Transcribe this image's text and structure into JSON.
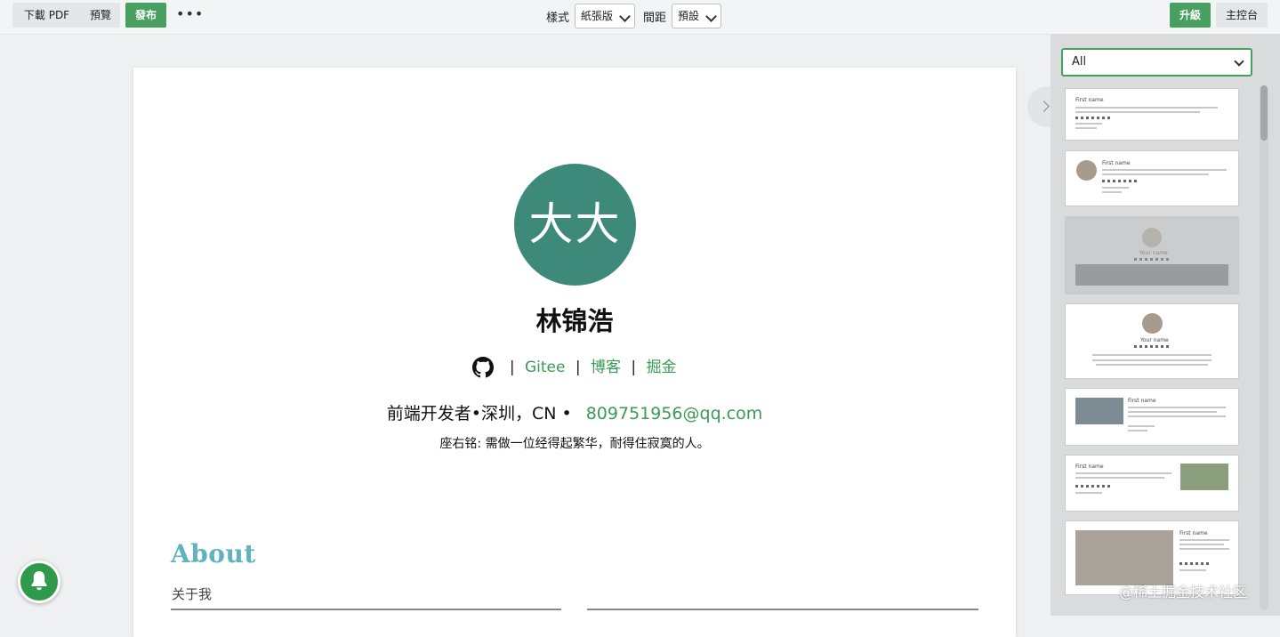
{
  "toolbar": {
    "download_pdf": "下載 PDF",
    "preview": "預覽",
    "publish": "發布",
    "more": "•••",
    "style_label": "樣式",
    "style_value": "紙張版",
    "spacing_label": "間距",
    "spacing_value": "預設",
    "upgrade": "升級",
    "dashboard": "主控台"
  },
  "resume": {
    "avatar_text": "大大",
    "name": "林锦浩",
    "links": [
      "Gitee",
      "博客",
      "掘金"
    ],
    "link_sep": "|",
    "info": "前端开发者•深圳，CN •",
    "email": "809751956@qq.com",
    "motto": "座右铭: 需做一位经得起繁华，耐得住寂寞的人。",
    "about_title": "About",
    "about_sub": "关于我"
  },
  "sidebar": {
    "filter_value": "All",
    "templates": [
      {
        "name": "First name"
      },
      {
        "name": "First name"
      },
      {
        "name": "Your name"
      },
      {
        "name": "Your name"
      },
      {
        "name": "First name"
      },
      {
        "name": "First name"
      },
      {
        "name": "First name"
      }
    ]
  },
  "watermark": "@稀土掘金技术社区",
  "colors": {
    "accent_green": "#47a05f",
    "link_green": "#3a9b55",
    "avatar_teal": "#3e8a7a",
    "about_cyan": "#5fb3be"
  }
}
